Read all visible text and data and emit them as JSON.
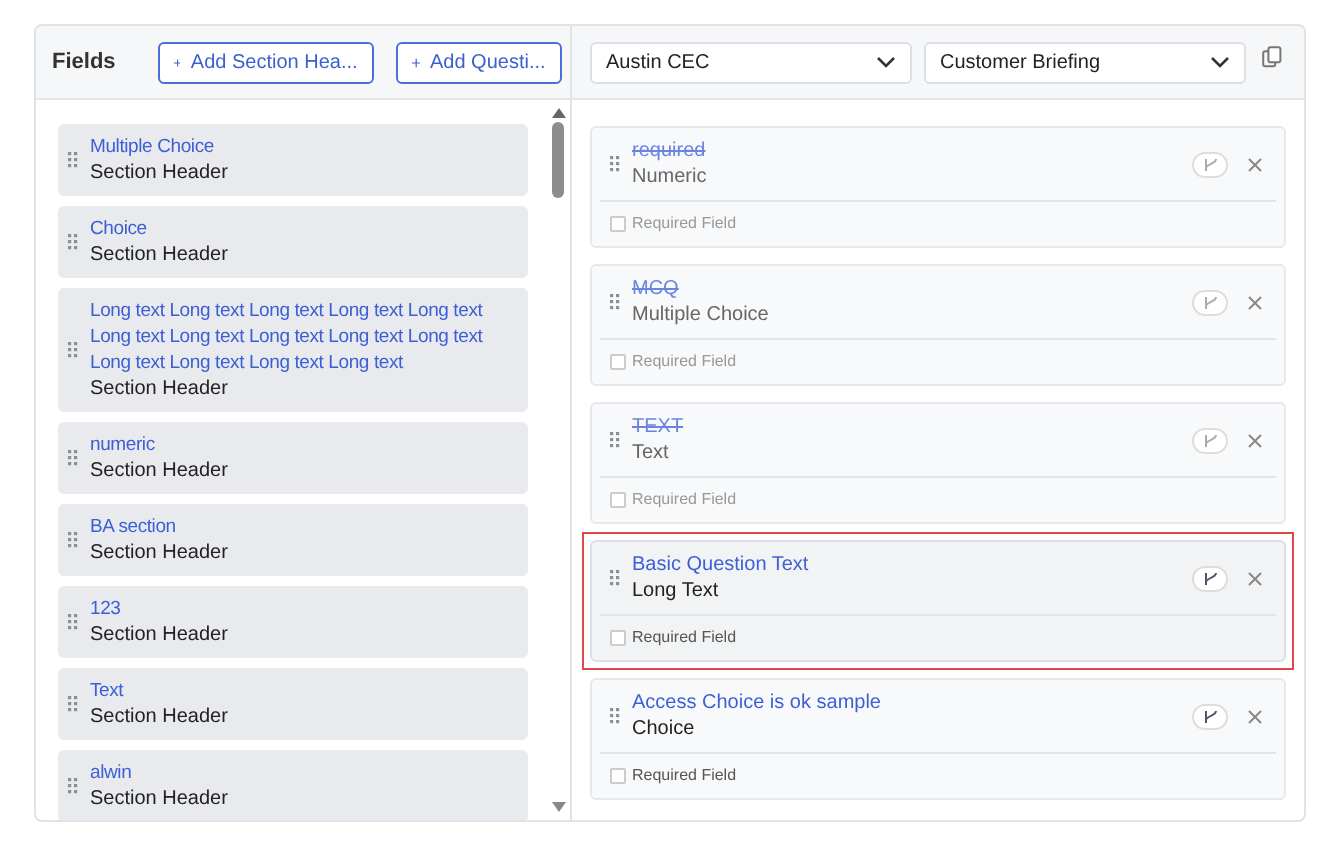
{
  "fields_panel": {
    "title": "Fields",
    "buttons": [
      "Add Section Hea...",
      "Add Questi..."
    ],
    "items": [
      {
        "title": "Multiple Choice",
        "type": "Section Header"
      },
      {
        "title": "Choice",
        "type": "Section Header"
      },
      {
        "title": "Long text Long text Long text Long text Long text Long text Long text Long text Long text Long text Long text Long text Long text Long text",
        "type": "Section Header"
      },
      {
        "title": "numeric",
        "type": "Section Header"
      },
      {
        "title": "BA section",
        "type": "Section Header"
      },
      {
        "title": "123",
        "type": "Section Header"
      },
      {
        "title": "Text",
        "type": "Section Header"
      },
      {
        "title": "alwin",
        "type": "Section Header"
      }
    ]
  },
  "form_panel": {
    "selects": [
      {
        "value": "Austin CEC"
      },
      {
        "value": "Customer Briefing"
      }
    ],
    "questions": [
      {
        "title": "required",
        "type": "Numeric",
        "struck": true,
        "selected": false,
        "required_label": "Required Field",
        "checked": false
      },
      {
        "title": "MCQ",
        "type": "Multiple Choice",
        "struck": true,
        "selected": false,
        "required_label": "Required Field",
        "checked": false
      },
      {
        "title": "TEXT",
        "type": "Text",
        "struck": true,
        "selected": false,
        "required_label": "Required Field",
        "checked": false
      },
      {
        "title": "Basic Question Text",
        "type": "Long Text",
        "struck": false,
        "selected": true,
        "required_label": "Required Field",
        "checked": false
      },
      {
        "title": "Access Choice is ok sample",
        "type": "Choice",
        "struck": false,
        "selected": false,
        "required_label": "Required Field",
        "checked": false
      }
    ]
  }
}
